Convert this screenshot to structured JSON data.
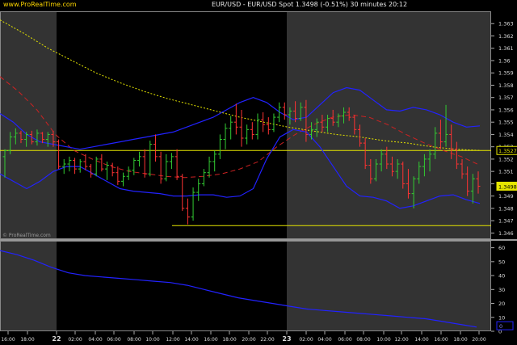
{
  "header": {
    "site": "www.ProRealTime.com",
    "title": "EUR/USD - EUR/USD Spot  1.3498 (-0.51%)  30 minutes  20:12"
  },
  "watermark": "© ProRealTime.com",
  "colors": {
    "background": "#000000",
    "session_shade": "#333333",
    "candle_up": "#33cc33",
    "candle_down": "#ff3333",
    "bollinger": "#2222ff",
    "moving_average": "#e6e600",
    "ema_dashed": "#cc2222",
    "horizontal_level": "#e6e600",
    "price_box": "#e6e600",
    "indicator_line": "#2222ff"
  },
  "chart_data": [
    {
      "type": "candlestick",
      "title": "EUR/USD - EUR/USD Spot",
      "timeframe": "30 minutes",
      "last_price": 1.3498,
      "change_pct": -0.51,
      "x_tick_labels": [
        "16:00",
        "18:00",
        "22",
        "02:00",
        "04:00",
        "06:00",
        "08:00",
        "10:00",
        "12:00",
        "14:00",
        "16:00",
        "18:00",
        "20:00",
        "22:00",
        "23",
        "02:00",
        "04:00",
        "06:00",
        "08:00",
        "10:00",
        "12:00",
        "14:00",
        "16:00",
        "18:00",
        "20:00"
      ],
      "y_ticks": [
        1.346,
        1.347,
        1.348,
        1.349,
        1.35,
        1.351,
        1.352,
        1.353,
        1.354,
        1.355,
        1.356,
        1.357,
        1.358,
        1.359,
        1.36,
        1.361,
        1.362,
        1.363
      ],
      "y_tick_labels": [
        "1.346",
        "1.347",
        "1.348",
        "1.349",
        "1.35",
        "1.351",
        "1.352",
        "1.353",
        "1.354",
        "1.355",
        "1.356",
        "1.357",
        "1.358",
        "1.359",
        "1.36",
        "1.361",
        "1.362",
        "1.363"
      ],
      "ylim": [
        1.3455,
        1.364
      ],
      "price_labels": [
        "1.3527",
        "1.3498"
      ],
      "horizontal_levels": [
        1.3527,
        1.3466
      ],
      "candles": [
        [
          1.3522,
          1.3528,
          1.3505,
          1.3527
        ],
        [
          1.3527,
          1.3542,
          1.3524,
          1.3538
        ],
        [
          1.3538,
          1.3545,
          1.3532,
          1.3541
        ],
        [
          1.3541,
          1.3543,
          1.3533,
          1.3536
        ],
        [
          1.3536,
          1.3542,
          1.353,
          1.354
        ],
        [
          1.354,
          1.3543,
          1.3532,
          1.3534
        ],
        [
          1.3534,
          1.3544,
          1.3531,
          1.3541
        ],
        [
          1.3541,
          1.3542,
          1.3533,
          1.3536
        ],
        [
          1.3536,
          1.3542,
          1.353,
          1.354
        ],
        [
          1.354,
          1.3543,
          1.353,
          1.3534
        ],
        [
          1.3534,
          1.3536,
          1.3512,
          1.3514
        ],
        [
          1.3514,
          1.352,
          1.3508,
          1.3516
        ],
        [
          1.3516,
          1.3522,
          1.351,
          1.3519
        ],
        [
          1.3519,
          1.3521,
          1.3508,
          1.3512
        ],
        [
          1.3512,
          1.352,
          1.3509,
          1.3518
        ],
        [
          1.3518,
          1.3524,
          1.3511,
          1.3514
        ],
        [
          1.3514,
          1.3516,
          1.3505,
          1.3508
        ],
        [
          1.3508,
          1.3522,
          1.3506,
          1.352
        ],
        [
          1.352,
          1.3524,
          1.351,
          1.3512
        ],
        [
          1.3512,
          1.3518,
          1.3503,
          1.3515
        ],
        [
          1.3515,
          1.3517,
          1.3506,
          1.3509
        ],
        [
          1.3509,
          1.3514,
          1.3499,
          1.3502
        ],
        [
          1.3502,
          1.3509,
          1.3498,
          1.3506
        ],
        [
          1.3506,
          1.3514,
          1.3503,
          1.3511
        ],
        [
          1.3511,
          1.3521,
          1.3507,
          1.3519
        ],
        [
          1.3519,
          1.3526,
          1.3514,
          1.3522
        ],
        [
          1.3522,
          1.3528,
          1.3505,
          1.3508
        ],
        [
          1.3508,
          1.3535,
          1.3506,
          1.3532
        ],
        [
          1.3532,
          1.354,
          1.3518,
          1.3522
        ],
        [
          1.3522,
          1.3526,
          1.35,
          1.3504
        ],
        [
          1.3504,
          1.3524,
          1.3502,
          1.3518
        ],
        [
          1.3518,
          1.3525,
          1.3512,
          1.3522
        ],
        [
          1.3522,
          1.3528,
          1.3503,
          1.3506
        ],
        [
          1.3506,
          1.3508,
          1.3478,
          1.348
        ],
        [
          1.348,
          1.3488,
          1.3467,
          1.3473
        ],
        [
          1.3473,
          1.3497,
          1.347,
          1.3493
        ],
        [
          1.3493,
          1.3504,
          1.3486,
          1.35
        ],
        [
          1.35,
          1.3512,
          1.3498,
          1.3509
        ],
        [
          1.3509,
          1.3522,
          1.3505,
          1.3518
        ],
        [
          1.3518,
          1.3527,
          1.351,
          1.3524
        ],
        [
          1.3524,
          1.354,
          1.352,
          1.3536
        ],
        [
          1.3536,
          1.3549,
          1.3528,
          1.3545
        ],
        [
          1.3545,
          1.3555,
          1.3536,
          1.355
        ],
        [
          1.355,
          1.3565,
          1.354,
          1.3546
        ],
        [
          1.3546,
          1.356,
          1.353,
          1.3537
        ],
        [
          1.3537,
          1.3548,
          1.3532,
          1.3544
        ],
        [
          1.3544,
          1.355,
          1.3536,
          1.354
        ],
        [
          1.354,
          1.3557,
          1.3536,
          1.3552
        ],
        [
          1.3552,
          1.3558,
          1.3542,
          1.3548
        ],
        [
          1.3548,
          1.3554,
          1.354,
          1.3544
        ],
        [
          1.3544,
          1.3557,
          1.3542,
          1.3554
        ],
        [
          1.3554,
          1.3566,
          1.355,
          1.3562
        ],
        [
          1.3562,
          1.3566,
          1.3552,
          1.3556
        ],
        [
          1.3556,
          1.3562,
          1.3548,
          1.3559
        ],
        [
          1.3559,
          1.3567,
          1.355,
          1.3553
        ],
        [
          1.3553,
          1.3566,
          1.3551,
          1.3562
        ],
        [
          1.3562,
          1.3568,
          1.3534,
          1.354
        ],
        [
          1.354,
          1.355,
          1.3536,
          1.3544
        ],
        [
          1.3544,
          1.3553,
          1.3538,
          1.355
        ],
        [
          1.355,
          1.3556,
          1.3542,
          1.3546
        ],
        [
          1.3546,
          1.3556,
          1.3542,
          1.3553
        ],
        [
          1.3553,
          1.356,
          1.3547,
          1.355
        ],
        [
          1.355,
          1.3557,
          1.3546,
          1.3555
        ],
        [
          1.3555,
          1.3562,
          1.3549,
          1.3558
        ],
        [
          1.3558,
          1.3562,
          1.3551,
          1.3554
        ],
        [
          1.3554,
          1.3556,
          1.354,
          1.3544
        ],
        [
          1.3544,
          1.3548,
          1.353,
          1.3533
        ],
        [
          1.3533,
          1.3537,
          1.3512,
          1.3515
        ],
        [
          1.3515,
          1.352,
          1.35,
          1.3504
        ],
        [
          1.3504,
          1.352,
          1.3502,
          1.3516
        ],
        [
          1.3516,
          1.3528,
          1.351,
          1.3524
        ],
        [
          1.3524,
          1.353,
          1.3512,
          1.3516
        ],
        [
          1.3516,
          1.3522,
          1.3506,
          1.351
        ],
        [
          1.351,
          1.352,
          1.3504,
          1.3516
        ],
        [
          1.3516,
          1.3518,
          1.3496,
          1.35
        ],
        [
          1.35,
          1.3512,
          1.3488,
          1.3492
        ],
        [
          1.3492,
          1.3506,
          1.348,
          1.3504
        ],
        [
          1.3504,
          1.3518,
          1.35,
          1.3514
        ],
        [
          1.3514,
          1.3524,
          1.3506,
          1.352
        ],
        [
          1.352,
          1.3528,
          1.351,
          1.3524
        ],
        [
          1.3524,
          1.3546,
          1.352,
          1.3541
        ],
        [
          1.3541,
          1.3552,
          1.3528,
          1.3534
        ],
        [
          1.3534,
          1.3564,
          1.353,
          1.354
        ],
        [
          1.354,
          1.3548,
          1.352,
          1.3528
        ],
        [
          1.3528,
          1.3534,
          1.3512,
          1.3516
        ],
        [
          1.3516,
          1.352,
          1.3504,
          1.3508
        ],
        [
          1.3508,
          1.3514,
          1.349,
          1.3494
        ],
        [
          1.3494,
          1.3508,
          1.3484,
          1.3504
        ],
        [
          1.3504,
          1.351,
          1.3492,
          1.3498
        ]
      ],
      "bollinger_upper": [
        1.3557,
        1.355,
        1.354,
        1.3534,
        1.3532,
        1.353,
        1.3528,
        1.353,
        1.3532,
        1.3534,
        1.3536,
        1.3538,
        1.354,
        1.3542,
        1.3546,
        1.355,
        1.3554,
        1.356,
        1.3566,
        1.357,
        1.3566,
        1.3558,
        1.3552,
        1.3554,
        1.3564,
        1.3574,
        1.3578,
        1.3576,
        1.3568,
        1.356,
        1.3559,
        1.3562,
        1.356,
        1.3556,
        1.355,
        1.3546,
        1.3547
      ],
      "bollinger_lower": [
        1.3508,
        1.3502,
        1.3496,
        1.3502,
        1.351,
        1.3514,
        1.3514,
        1.3508,
        1.3502,
        1.3496,
        1.3494,
        1.3493,
        1.3492,
        1.349,
        1.349,
        1.3491,
        1.3491,
        1.3489,
        1.349,
        1.3496,
        1.352,
        1.3538,
        1.3544,
        1.3542,
        1.353,
        1.3514,
        1.3498,
        1.349,
        1.3489,
        1.3486,
        1.348,
        1.3482,
        1.3486,
        1.349,
        1.3491,
        1.3487,
        1.3484
      ],
      "moving_average": [
        1.3633,
        1.3622,
        1.361,
        1.36,
        1.359,
        1.3582,
        1.3575,
        1.3569,
        1.3564,
        1.3559,
        1.3554,
        1.355,
        1.3546,
        1.3543,
        1.354,
        1.3538,
        1.3535,
        1.3533,
        1.353,
        1.3528,
        1.3527
      ],
      "ema_dashed": [
        1.3587,
        1.3575,
        1.356,
        1.354,
        1.3527,
        1.352,
        1.3514,
        1.351,
        1.3508,
        1.3506,
        1.3505,
        1.3506,
        1.3508,
        1.3512,
        1.3518,
        1.353,
        1.354,
        1.3548,
        1.3554,
        1.3556,
        1.3554,
        1.3548,
        1.354,
        1.3533,
        1.3527,
        1.3522,
        1.3515
      ]
    },
    {
      "type": "line",
      "title": "",
      "y_ticks": [
        0,
        10,
        20,
        30,
        40,
        50,
        60
      ],
      "y_tick_labels": [
        "0",
        "10",
        "20",
        "30",
        "40",
        "50",
        "60"
      ],
      "ylim": [
        0,
        65
      ],
      "current_label": "0",
      "values": [
        58,
        55,
        51,
        46,
        42,
        40,
        39,
        38,
        37,
        36,
        35,
        33,
        30,
        27,
        24,
        22,
        20,
        18,
        16,
        15,
        14,
        13,
        12,
        11,
        10,
        9,
        7,
        5,
        3
      ]
    }
  ]
}
